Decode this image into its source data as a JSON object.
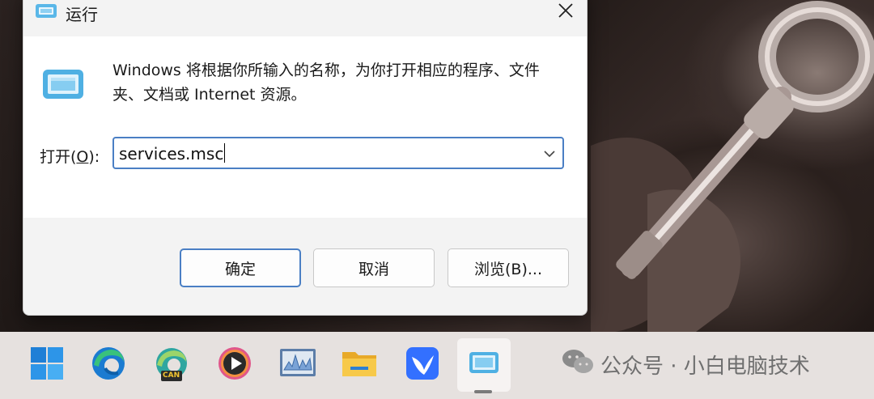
{
  "dialog": {
    "title": "运行",
    "description": "Windows 将根据你所输入的名称，为你打开相应的程序、文件夹、文档或 Internet 资源。",
    "open_label_pre": "打开(",
    "open_label_key": "O",
    "open_label_post": "):",
    "input_value": "services.msc",
    "ok_label": "确定",
    "cancel_label": "取消",
    "browse_label": "浏览(B)..."
  },
  "taskbar": {
    "items": [
      "start-icon",
      "edge-icon",
      "edge-canary-icon",
      "media-player-icon",
      "performance-monitor-icon",
      "file-explorer-icon",
      "feishu-icon",
      "run-icon"
    ],
    "canary_badge": "CAN",
    "active_item": "run-icon"
  },
  "watermark": {
    "text": "公众号 · 小白电脑技术"
  },
  "colors": {
    "accent": "#4a7fc4",
    "dialog_bg": "#f3f3f3",
    "taskbar_bg": "#e6e1df"
  }
}
